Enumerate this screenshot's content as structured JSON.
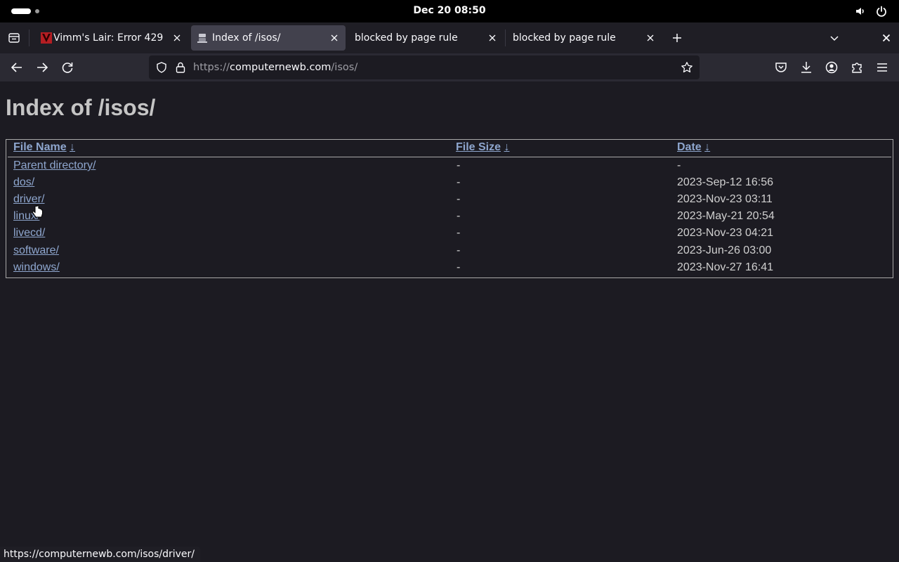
{
  "system": {
    "clock": "Dec 20  08:50"
  },
  "tabs": [
    {
      "title": "Vimm's Lair: Error 429",
      "favicon": "vimm-logo-icon",
      "active": false
    },
    {
      "title": "Index of /isos/",
      "favicon": "server-icon",
      "active": true
    },
    {
      "title": "blocked by page rule",
      "favicon": "",
      "active": false
    },
    {
      "title": "blocked by page rule",
      "favicon": "",
      "active": false
    }
  ],
  "urlbar": {
    "scheme": "https://",
    "host": "computernewb.com",
    "path": "/isos/"
  },
  "page": {
    "title": "Index of /isos/",
    "columns": [
      {
        "label": "File Name",
        "sort": "↓"
      },
      {
        "label": "File Size",
        "sort": "↓"
      },
      {
        "label": "Date",
        "sort": "↓"
      }
    ],
    "rows": [
      {
        "name": "Parent directory/",
        "size": "-",
        "date": "-"
      },
      {
        "name": "dos/",
        "size": "-",
        "date": "2023-Sep-12 16:56"
      },
      {
        "name": "driver/",
        "size": "-",
        "date": "2023-Nov-23 03:11"
      },
      {
        "name": "linux/",
        "size": "-",
        "date": "2023-May-21 20:54"
      },
      {
        "name": "livecd/",
        "size": "-",
        "date": "2023-Nov-23 04:21"
      },
      {
        "name": "software/",
        "size": "-",
        "date": "2023-Jun-26 03:00"
      },
      {
        "name": "windows/",
        "size": "-",
        "date": "2023-Nov-27 16:41"
      }
    ]
  },
  "status_bar": {
    "hover_url": "https://computernewb.com/isos/driver/"
  },
  "colors": {
    "link": "#8ea6ce",
    "page_bg": "#1c1b22",
    "toolbar_bg": "#2b2a33",
    "active_tab": "#42414d"
  }
}
